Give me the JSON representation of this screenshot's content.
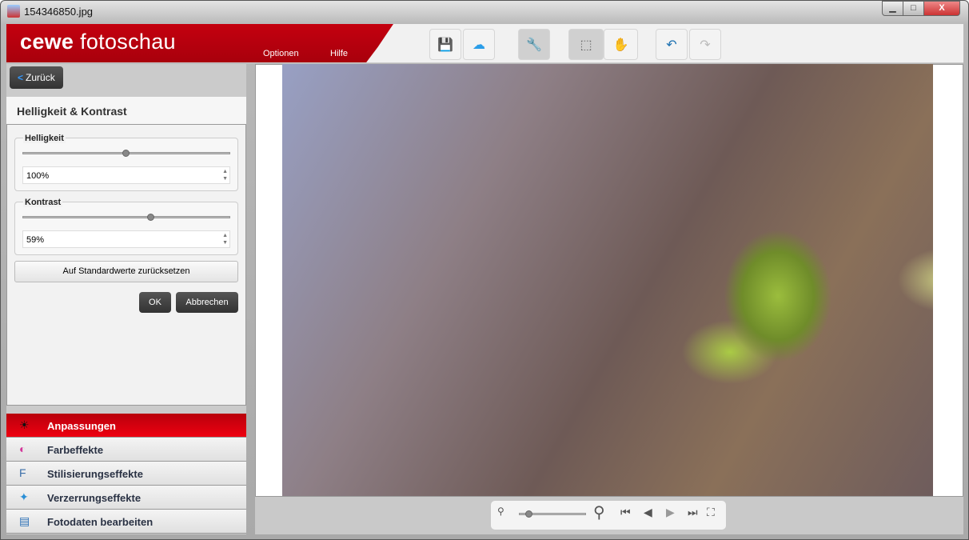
{
  "window": {
    "title": "154346850.jpg",
    "minimize": "▁",
    "maximize": "□",
    "close": "X"
  },
  "header": {
    "logo_bold": "cewe",
    "logo_light": "fotoschau",
    "menu": [
      "Optionen",
      "Hilfe"
    ]
  },
  "toolbar": {
    "save": "💾",
    "upload": "☁",
    "tools": "🔧",
    "select": "⬚",
    "pan": "✋",
    "undo": "↶",
    "redo": "↷"
  },
  "panel": {
    "back": "Zurück",
    "title": "Helligkeit & Kontrast",
    "brightness": {
      "label": "Helligkeit",
      "value": "100%",
      "fraction": 0.5
    },
    "contrast": {
      "label": "Kontrast",
      "value": "59%",
      "fraction": 0.62
    },
    "reset": "Auf Standardwerte zurücksetzen",
    "ok": "OK",
    "cancel": "Abbrechen"
  },
  "nav": [
    {
      "label": "Anpassungen",
      "icon": "☀"
    },
    {
      "label": "Farbeffekte",
      "icon": "◐"
    },
    {
      "label": "Stilisierungseffekte",
      "icon": "F"
    },
    {
      "label": "Verzerrungseffekte",
      "icon": "✦"
    },
    {
      "label": "Fotodaten bearbeiten",
      "icon": "▤"
    }
  ],
  "viewer": {
    "zoom_fraction": 0.15
  }
}
